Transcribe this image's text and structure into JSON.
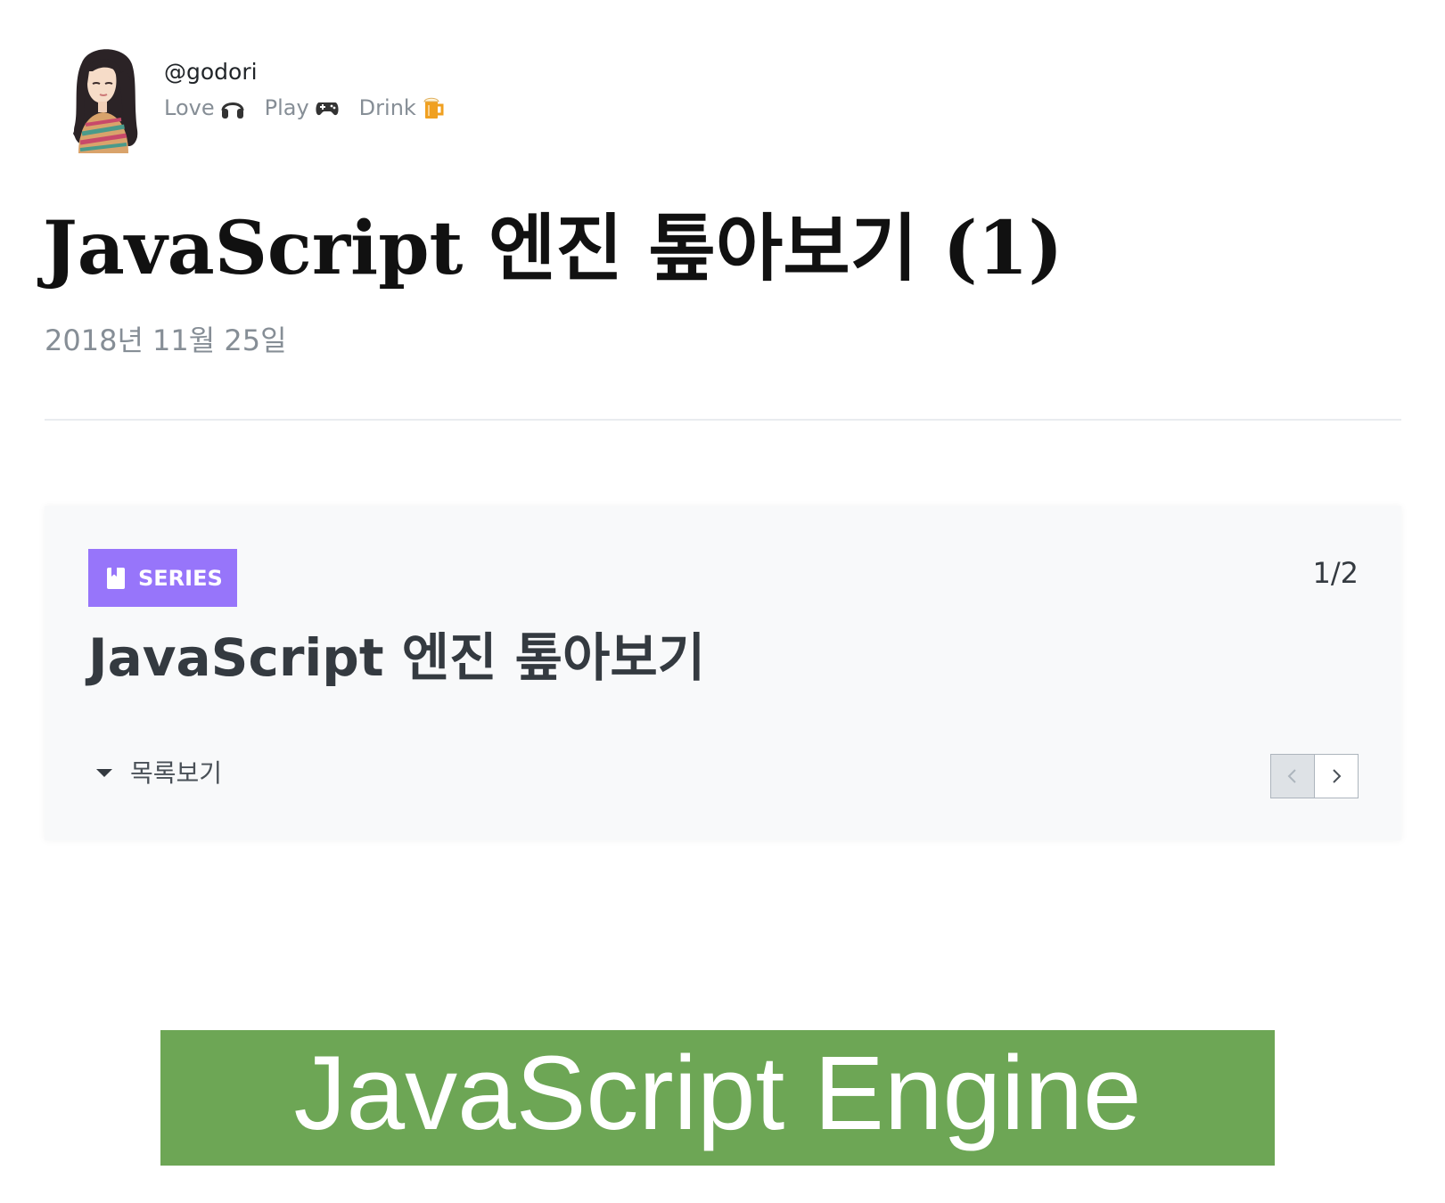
{
  "author": {
    "username": "@godori",
    "bio": [
      {
        "word": "Love",
        "icon": "headphones-icon"
      },
      {
        "word": "Play",
        "icon": "gamepad-icon"
      },
      {
        "word": "Drink",
        "icon": "beer-icon"
      }
    ]
  },
  "post": {
    "title": "JavaScript 엔진 톺아보기 (1)",
    "date": "2018년 11월 25일"
  },
  "series": {
    "badge_label": "SERIES",
    "count": "1/2",
    "name": "JavaScript 엔진 톺아보기",
    "toggle_label": "목록보기",
    "badge_color": "#9775fa"
  },
  "banner": {
    "text": "JavaScript Engine",
    "color": "#6da655"
  }
}
